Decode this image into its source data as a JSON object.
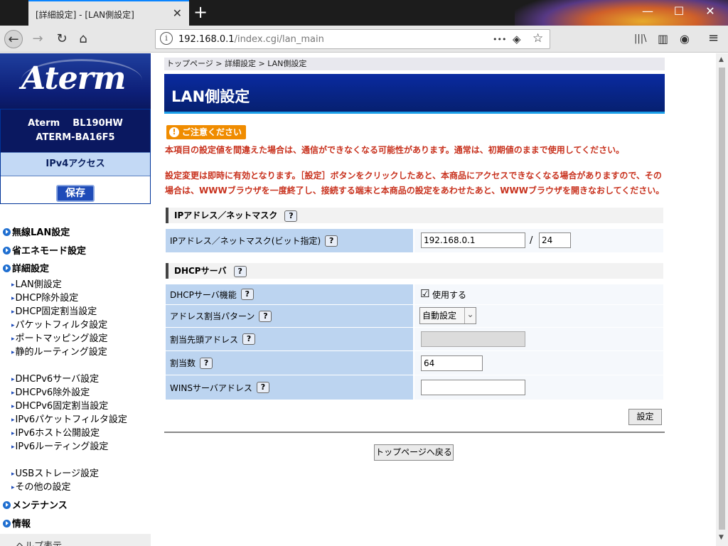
{
  "browser": {
    "tab_title": "[詳細設定] - [LAN側設定]",
    "tab_close": "✕",
    "new_tab": "+",
    "url_host": "192.168.0.1",
    "url_path": "/index.cgi/lan_main",
    "url_info": "i",
    "window": {
      "minimize": "—",
      "maximize": "☐",
      "close": "✕"
    },
    "nav": {
      "back": "←",
      "forward": "→",
      "reload": "↻",
      "home": "⌂"
    },
    "url_actions": {
      "more": "•••",
      "pocket": "◈",
      "star": "☆"
    },
    "toolbar": {
      "library": "|||\\",
      "sidebar": "▥",
      "addon": "◉",
      "menu": "≡"
    }
  },
  "sidebar": {
    "logo": "Aterm",
    "model_line1": "Aterm    BL190HW",
    "model_line2": "ATERM-BA16F5",
    "mode": "IPv4アクセス",
    "save_label": "保存",
    "menu": [
      {
        "type": "head",
        "label": "無線LAN設定"
      },
      {
        "type": "head",
        "label": "省エネモード設定"
      },
      {
        "type": "head",
        "label": "詳細設定"
      },
      {
        "type": "sub",
        "label": "LAN側設定"
      },
      {
        "type": "sub",
        "label": "DHCP除外設定"
      },
      {
        "type": "sub",
        "label": "DHCP固定割当設定"
      },
      {
        "type": "sub",
        "label": "パケットフィルタ設定"
      },
      {
        "type": "sub",
        "label": "ポートマッピング設定"
      },
      {
        "type": "sub",
        "label": "静的ルーティング設定"
      },
      {
        "type": "sub",
        "label": "DHCPv6サーバ設定"
      },
      {
        "type": "sub",
        "label": "DHCPv6除外設定"
      },
      {
        "type": "sub",
        "label": "DHCPv6固定割当設定"
      },
      {
        "type": "sub",
        "label": "IPv6パケットフィルタ設定"
      },
      {
        "type": "sub",
        "label": "IPv6ホスト公開設定"
      },
      {
        "type": "sub",
        "label": "IPv6ルーティング設定"
      },
      {
        "type": "sub",
        "label": "USBストレージ設定"
      },
      {
        "type": "sub",
        "label": "その他の設定"
      },
      {
        "type": "head",
        "label": "メンテナンス"
      },
      {
        "type": "head",
        "label": "情報"
      }
    ],
    "bottom_label": "ヘルプ表示"
  },
  "main": {
    "breadcrumb": "トップページ > 詳細設定 > LAN側設定",
    "title": "LAN側設定",
    "caution": "ご注意ください",
    "caution_icon": "!",
    "warning1": "本項目の設定値を間違えた場合は、通信ができなくなる可能性があります。通常は、初期値のままで使用してください。",
    "warning2": "設定変更は即時に有効となります。［設定］ボタンをクリックしたあと、本商品にアクセスできなくなる場合がありますので、その場合は、WWWブラウザを一度終了し、接続する端末と本商品の設定をあわせたあと、WWWブラウザを開きなおしてください。",
    "help": "?",
    "ip_section": {
      "title": "IPアドレス／ネットマスク",
      "label": "IPアドレス／ネットマスク(ビット指定)",
      "ip_value": "192.168.0.1",
      "slash": "/",
      "mask_value": "24"
    },
    "dhcp_section": {
      "title": "DHCPサーバ",
      "function_label": "DHCPサーバ機能",
      "function_checkbox": "☑",
      "function_value": "使用する",
      "pattern_label": "アドレス割当パターン",
      "pattern_value": "自動設定",
      "pattern_arrow": "⌄",
      "start_label": "割当先頭アドレス",
      "start_value": "",
      "count_label": "割当数",
      "count_value": "64",
      "wins_label": "WINSサーバアドレス",
      "wins_value": ""
    },
    "apply_label": "設定",
    "back_top_label": "トップページへ戻る"
  }
}
